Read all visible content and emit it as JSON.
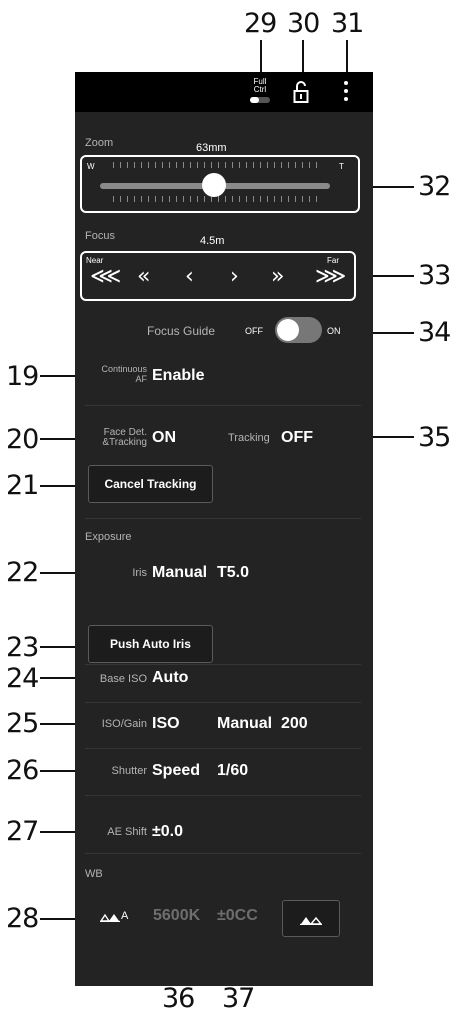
{
  "callouts": {
    "c29": "29",
    "c30": "30",
    "c31": "31",
    "c32": "32",
    "c33": "33",
    "c34": "34",
    "c35": "35",
    "c19": "19",
    "c20": "20",
    "c21": "21",
    "c22": "22",
    "c23": "23",
    "c24": "24",
    "c25": "25",
    "c26": "26",
    "c27": "27",
    "c28": "28",
    "c36": "36",
    "c37": "37"
  },
  "topbar": {
    "full_ctrl_line1": "Full",
    "full_ctrl_line2": "Ctrl",
    "lock_icon": "unlock-icon",
    "menu_icon": "vertical-dots-icon"
  },
  "zoom": {
    "label": "Zoom",
    "value": "63mm",
    "wide": "W",
    "tele": "T",
    "slider_position": 0.38
  },
  "focus": {
    "label": "Focus",
    "value": "4.5m",
    "near": "Near",
    "far": "Far",
    "buttons": [
      "⋘",
      "«",
      "‹",
      "›",
      "»",
      "⋙"
    ]
  },
  "focus_guide": {
    "label": "Focus Guide",
    "off": "OFF",
    "on": "ON",
    "state": "on"
  },
  "continuous_af": {
    "label_line1": "Continuous",
    "label_line2": "AF",
    "value": "Enable"
  },
  "face_det": {
    "label_line1": "Face Det.",
    "label_line2": "&Tracking",
    "value": "ON"
  },
  "tracking": {
    "label": "Tracking",
    "value": "OFF"
  },
  "cancel_tracking": {
    "label": "Cancel Tracking"
  },
  "exposure": {
    "section": "Exposure"
  },
  "iris": {
    "label": "Iris",
    "mode": "Manual",
    "value": "T5.0"
  },
  "push_auto_iris": {
    "label": "Push Auto Iris"
  },
  "base_iso": {
    "label": "Base ISO",
    "value": "Auto"
  },
  "iso_gain": {
    "label": "ISO/Gain",
    "type": "ISO",
    "mode": "Manual",
    "value": "200"
  },
  "shutter": {
    "label": "Shutter",
    "mode": "Speed",
    "value": "1/60"
  },
  "ae_shift": {
    "label": "AE Shift",
    "value": "±0.0"
  },
  "wb": {
    "section": "WB",
    "mode_suffix": "A",
    "kelvin": "5600K",
    "cc": "±0CC",
    "set_icon": "wb-set-icon"
  },
  "colors": {
    "background": "#232323",
    "accent": "#ffffff",
    "dim_text": "#6e6e6e"
  }
}
